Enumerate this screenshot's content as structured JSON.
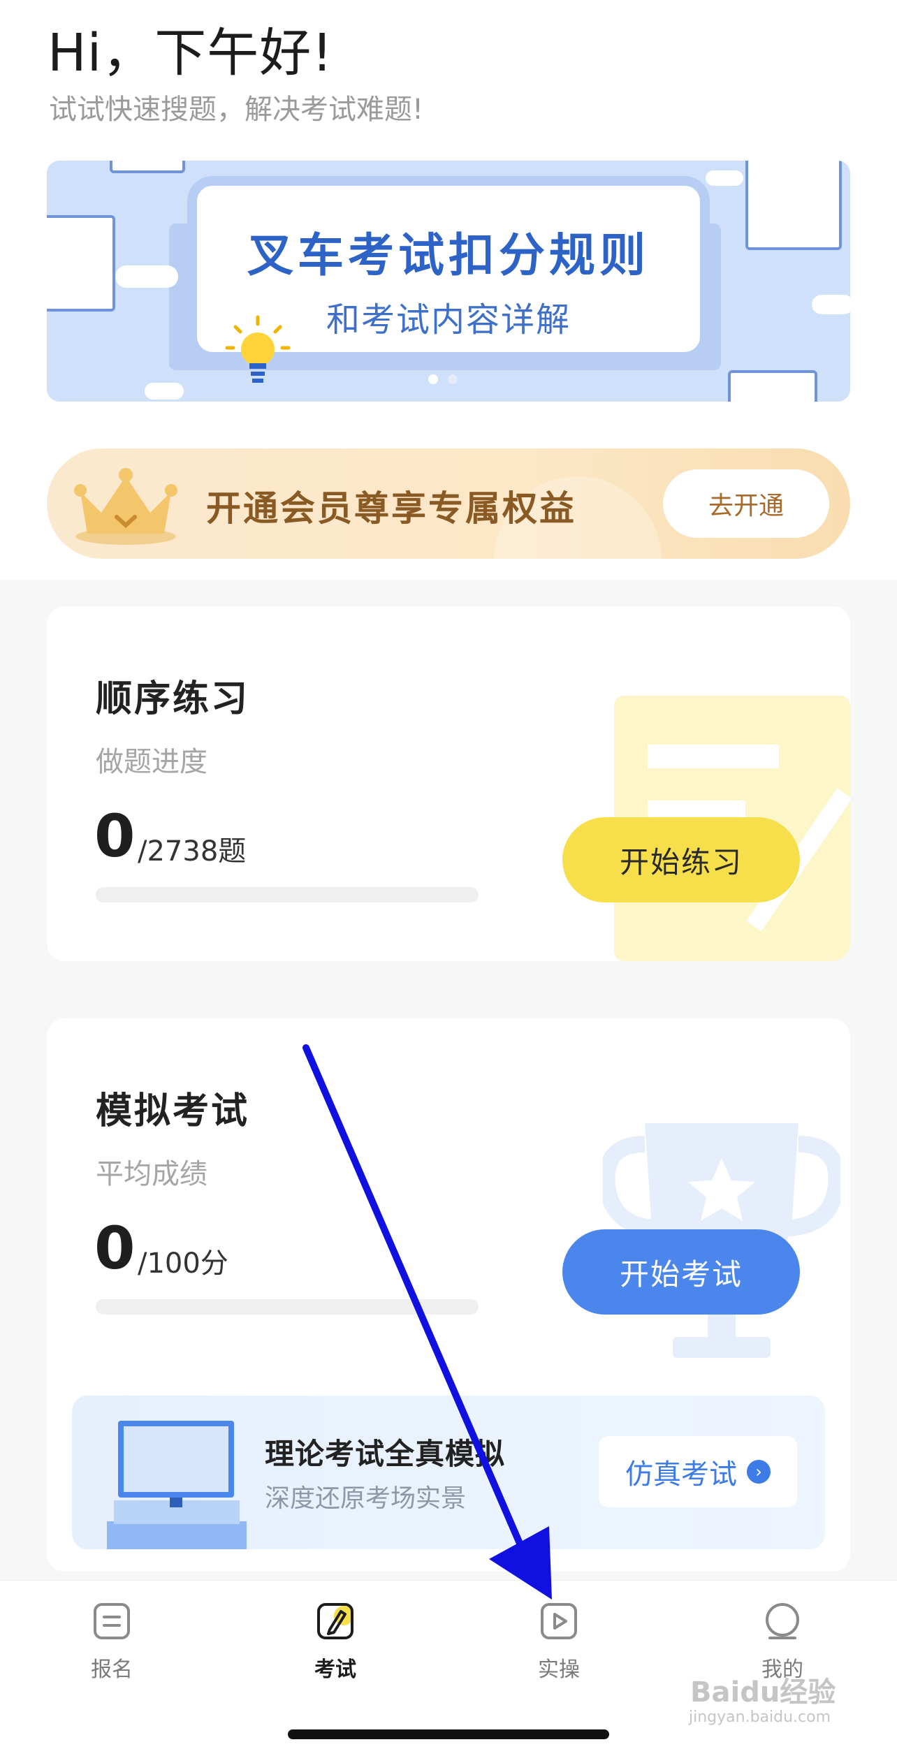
{
  "header": {
    "greeting": "Hi，下午好!",
    "subtitle": "试试快速搜题，解决考试难题!"
  },
  "banner": {
    "title": "叉车考试扣分规则",
    "subtitle": "和考试内容详解",
    "slides": 2,
    "active_slide": 1
  },
  "member": {
    "text": "开通会员尊享专属权益",
    "button": "去开通"
  },
  "practice": {
    "title": "顺序练习",
    "progress_label": "做题进度",
    "done": "0",
    "total": "/2738题",
    "progress_fraction": 0,
    "button": "开始练习"
  },
  "exam": {
    "title": "模拟考试",
    "score_label": "平均成绩",
    "score": "0",
    "total": "/100分",
    "progress_fraction": 0,
    "button": "开始考试"
  },
  "simulation": {
    "title": "理论考试全真模拟",
    "subtitle": "深度还原考场实景",
    "button": "仿真考试"
  },
  "tabs": [
    {
      "label": "报名",
      "icon": "form-icon"
    },
    {
      "label": "考试",
      "icon": "exam-pen-icon"
    },
    {
      "label": "实操",
      "icon": "play-icon"
    },
    {
      "label": "我的",
      "icon": "profile-icon"
    }
  ],
  "active_tab": 1,
  "watermark": {
    "brand": "Baidu经验",
    "url": "jingyan.baidu.com"
  },
  "colors": {
    "brand_blue": "#4a86ec",
    "yellow": "#f7de4b",
    "annotation_arrow": "#1010e0"
  }
}
